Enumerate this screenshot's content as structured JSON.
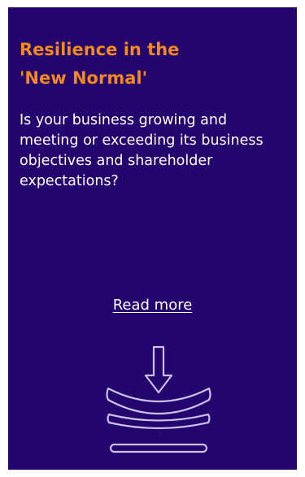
{
  "card": {
    "title": "Resilience in the\n'New Normal'",
    "description": "Is your business growing and meeting or exceeding its business objectives and shareholder expectations?",
    "link_label": "Read more",
    "icon": "resilience-pressure-icon"
  },
  "colors": {
    "background": "#24046f",
    "title": "#f08a1f",
    "text": "#ffffff",
    "icon_stroke": "#c9c2e6"
  }
}
